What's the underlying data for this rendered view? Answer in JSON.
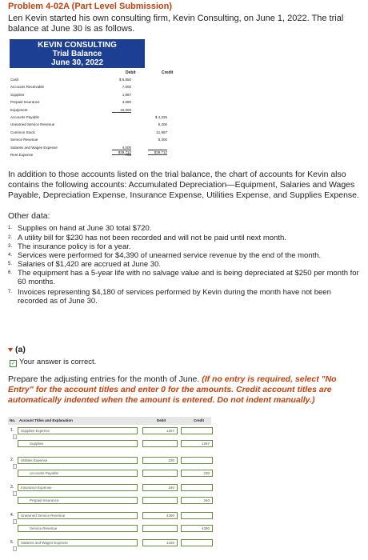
{
  "header": {
    "title": "Problem 4-02A (Part Level Submission)",
    "intro": "Len Kevin started his own consulting firm, Kevin Consulting, on June 1, 2022. The trial balance at June 30 is as follows."
  },
  "trial_balance": {
    "company": "KEVIN CONSULTING",
    "name": "Trial Balance",
    "date": "June 30, 2022",
    "debit_header": "Debit",
    "credit_header": "Credit",
    "rows": [
      {
        "account": "Cash",
        "debit": "$ 6,850",
        "credit": ""
      },
      {
        "account": "Accounts Receivable",
        "debit": "7,000",
        "credit": ""
      },
      {
        "account": "Supplies",
        "debit": "1,987",
        "credit": ""
      },
      {
        "account": "Prepaid Insurance",
        "debit": "4,080",
        "credit": ""
      },
      {
        "account": "Equipment",
        "debit": "15,000",
        "credit": ""
      },
      {
        "account": "Accounts Payable",
        "debit": "",
        "credit": "$ 4,225"
      },
      {
        "account": "Unearned Service Revenue",
        "debit": "",
        "credit": "5,200"
      },
      {
        "account": "Common Stock",
        "debit": "",
        "credit": "21,987"
      },
      {
        "account": "Service Revenue",
        "debit": "",
        "credit": "8,300"
      },
      {
        "account": "Salaries and Wages Expense",
        "debit": "4,000",
        "credit": ""
      },
      {
        "account": "Rent Expense",
        "debit": "795",
        "credit": ""
      }
    ],
    "total_debit": "$39,712",
    "total_credit": "$39,712"
  },
  "additional": "In addition to those accounts listed on the trial balance, the chart of accounts for Kevin also contains the following accounts: Accumulated Depreciation—Equipment, Salaries and Wages Payable, Depreciation Expense, Insurance Expense, Utilities Expense, and Supplies Expense.",
  "other_data_label": "Other data:",
  "other_data": [
    {
      "n": "1.",
      "text": "Supplies on hand at June 30 total $720."
    },
    {
      "n": "2.",
      "text": "A utility bill for $230 has not been recorded and will not be paid until next month."
    },
    {
      "n": "3.",
      "text": "The insurance policy is for a year."
    },
    {
      "n": "4.",
      "text": "Services were performed for $4,390 of unearned service revenue by the end of the month."
    },
    {
      "n": "5.",
      "text": "Salaries of $1,420 are accrued at June 30."
    },
    {
      "n": "6.",
      "text": "The equipment has a 5-year life with no salvage value and is being depreciated at $250 per month for 60 months."
    },
    {
      "n": "7.",
      "text": "Invoices representing $4,180 of services performed by Kevin during the month have not been recorded as of June 30."
    }
  ],
  "section_a": {
    "label": "(a)",
    "feedback": "Your answer is correct.",
    "instruction_plain": "Prepare the adjusting entries for the month of June. ",
    "instruction_italic": "(If no entry is required, select \"No Entry\" for the account titles and enter 0 for the amounts. Credit account titles are automatically indented when the amount is entered. Do not indent manually.)"
  },
  "journal": {
    "col_no": "No.",
    "col_titles": "Account Titles and Explanation",
    "col_debit": "Debit",
    "col_credit": "Credit",
    "entries": [
      {
        "no": "1.",
        "debit_account": "Supplies Expense",
        "debit": "1267",
        "credit_account": "Supplies",
        "credit": "1267"
      },
      {
        "no": "2.",
        "debit_account": "Utilities Expense",
        "debit": "230",
        "credit_account": "Accounts Payable",
        "credit": "230"
      },
      {
        "no": "3.",
        "debit_account": "Insurance Expense",
        "debit": "340",
        "credit_account": "Prepaid Insurance",
        "credit": "340"
      },
      {
        "no": "4.",
        "debit_account": "Unearned Service Revenue",
        "debit": "4390",
        "credit_account": "Service Revenue",
        "credit": "4390"
      },
      {
        "no": "5.",
        "debit_account": "Salaries and Wages Expense",
        "debit": "1420",
        "credit_account": "",
        "credit": ""
      }
    ]
  }
}
